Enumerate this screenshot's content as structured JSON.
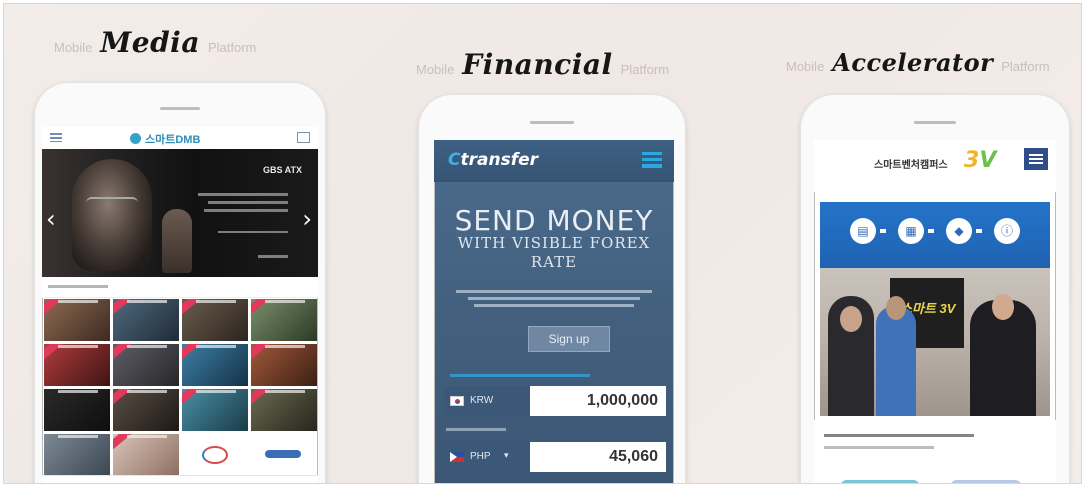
{
  "captions": [
    {
      "prefix": "Mobile",
      "title": "Media",
      "suffix": "Platform"
    },
    {
      "prefix": "Mobile",
      "title": "Financial",
      "suffix": "Platform"
    },
    {
      "prefix": "Mobile",
      "title": "Accelerator",
      "suffix": "Platform"
    }
  ],
  "media": {
    "logo": "스마트DMB",
    "banner_brand": "GBS ATX"
  },
  "financial": {
    "logo": "transfer",
    "headline": "SEND MONEY",
    "subheadline": "WITH VISIBLE FOREX RATE",
    "signup_label": "Sign up",
    "send_currency": "KRW",
    "send_amount": "1,000,000",
    "receive_currency": "PHP",
    "receive_amount": "45,060"
  },
  "accelerator": {
    "logo": "스마트벤처캠퍼스",
    "logo_mark": "3",
    "logo_mark_v": "V",
    "sign_text": "스마트 3V"
  },
  "colors": {
    "media_ribbon": "#e0395b",
    "financial_accent": "#2aa8e0",
    "accelerator_blue": "#2473c8"
  }
}
